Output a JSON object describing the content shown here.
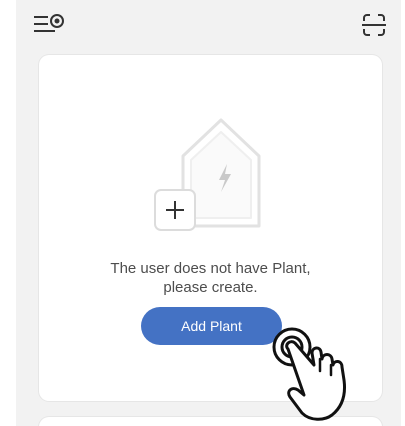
{
  "header": {
    "menu_icon": "menu-settings-icon",
    "scan_icon": "scan-icon"
  },
  "empty_state": {
    "illustration": "house-with-plus-icon",
    "message_line1": "The user does not have Plant,",
    "message_line2": "please create.",
    "button_label": "Add Plant",
    "button_color": "#4472c4"
  },
  "overlay": {
    "pointer_icon": "hand-pointer-icon"
  }
}
